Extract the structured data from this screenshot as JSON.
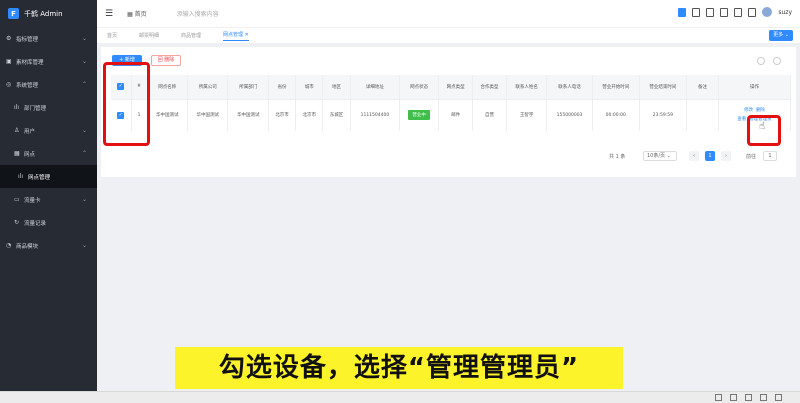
{
  "app": {
    "logo_text": "千鹤 Admin",
    "logo_mark": "F"
  },
  "sidebar": {
    "items": [
      {
        "label": "指标管理",
        "icon": "gear-icon",
        "chevron": true
      },
      {
        "label": "素材库管理",
        "icon": "image-icon",
        "chevron": true
      },
      {
        "label": "系统管理",
        "icon": "settings-icon",
        "chevron": true
      },
      {
        "label": "部门管理",
        "icon": "tree-icon",
        "chevron": false
      },
      {
        "label": "用户",
        "icon": "user-icon",
        "chevron": true
      },
      {
        "label": "网点",
        "icon": "grid-icon",
        "chevron": true
      },
      {
        "label": "网点管理",
        "icon": "tree-icon",
        "chevron": false
      },
      {
        "label": "流量卡",
        "icon": "card-icon",
        "chevron": true
      },
      {
        "label": "流量记录",
        "icon": "refresh-icon",
        "chevron": false
      },
      {
        "label": "商品模块",
        "icon": "cart-icon",
        "chevron": true
      }
    ]
  },
  "header": {
    "home_label": "首页",
    "search_placeholder": "添输入搜索内容",
    "username": "suzy"
  },
  "tabs": [
    {
      "label": "首页"
    },
    {
      "label": "邮票明细"
    },
    {
      "label": "商品管理"
    },
    {
      "label": "网点管理"
    }
  ],
  "more_label": "更多",
  "toolbar": {
    "add_label": "+ 新增",
    "delete_label": "回 删除"
  },
  "table": {
    "headers": [
      "",
      "#",
      "网点名称",
      "所属公司",
      "所属部门",
      "省份",
      "城市",
      "地区",
      "详细地址",
      "网点状态",
      "网点类型",
      "合作类型",
      "联系人姓名",
      "联系人电话",
      "营业开始时间",
      "营业结束时间",
      "备注",
      "操作"
    ],
    "row": [
      "",
      "1",
      "华中国测试",
      "华中国测试",
      "华中国测试",
      "北京市",
      "北京市",
      "东城区",
      "1111504400",
      "营业中",
      "邮件",
      "自营",
      "王智宇",
      "155000003",
      "00:00:00",
      "23:59:59",
      "",
      ""
    ],
    "ops": [
      "修改",
      "删除",
      "查看",
      "管理管理员"
    ]
  },
  "pager": {
    "total": "共 1 条",
    "page_size": "10条/页",
    "current_page": "1",
    "goto_label": "前往",
    "goto_value": "1"
  },
  "subtitle": "勾选设备，选择“管理管理员”"
}
